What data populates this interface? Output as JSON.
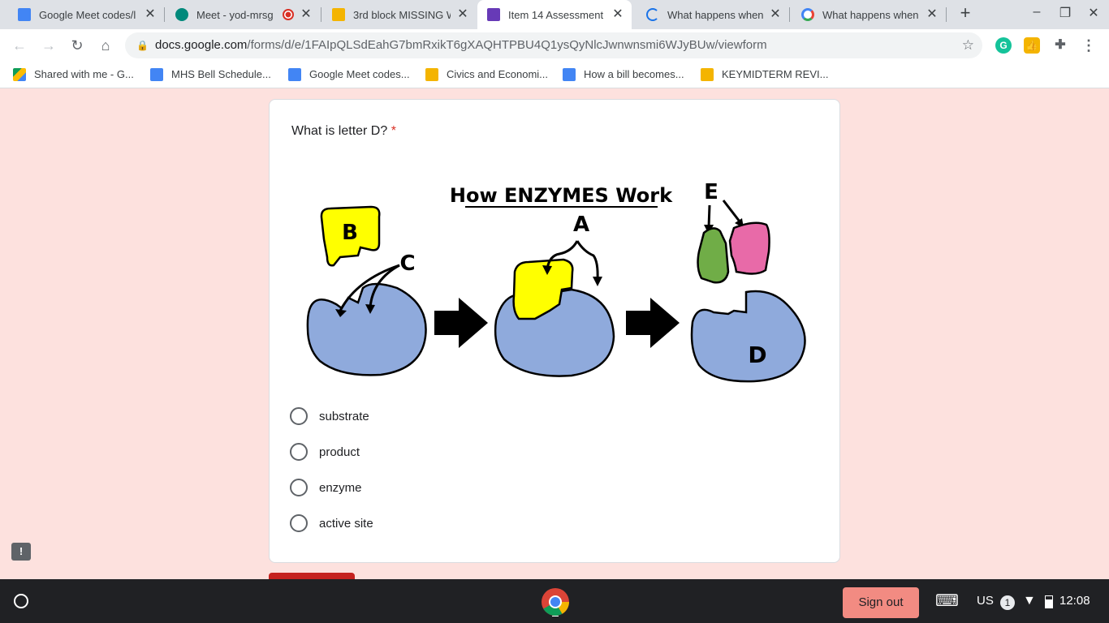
{
  "browser": {
    "tabs": [
      {
        "title": "Google Meet codes/l",
        "favicon_color": "#4285f4"
      },
      {
        "title": "Meet - yod-mrsg",
        "favicon_color": "#00897b"
      },
      {
        "title": "3rd block MISSING W",
        "favicon_color": "#f4b400"
      },
      {
        "title": "Item 14 Assessment",
        "favicon_color": "#673ab7"
      },
      {
        "title": "What happens when",
        "favicon_color": "#1a73e8"
      },
      {
        "title": "What happens when",
        "favicon_color": "#ea4335"
      }
    ],
    "address": {
      "host": "docs.google.com",
      "path": "/forms/d/e/1FAIpQLSdEahG7bmRxikT6gXAQHTPBU4Q1ysQyNlcJwnwnsmi6WJyBUw/viewform"
    },
    "bookmarks": [
      {
        "label": "Shared with me - G...",
        "icon_color": "#fbbc04"
      },
      {
        "label": "MHS Bell Schedule...",
        "icon_color": "#4285f4"
      },
      {
        "label": "Google Meet codes...",
        "icon_color": "#4285f4"
      },
      {
        "label": "Civics and Economi...",
        "icon_color": "#f4b400"
      },
      {
        "label": "How a bill becomes...",
        "icon_color": "#4285f4"
      },
      {
        "label": "KEYMIDTERM REVI...",
        "icon_color": "#f4b400"
      }
    ]
  },
  "form": {
    "question": "What is letter D?",
    "required_mark": "*",
    "diagram": {
      "title": "How ENZYMES Work",
      "labels": {
        "a": "A",
        "b": "B",
        "c": "C",
        "d": "D",
        "e": "E"
      }
    },
    "options": [
      "substrate",
      "product",
      "enzyme",
      "active site"
    ],
    "feedback_icon": "!"
  },
  "shelf": {
    "sign_out": "Sign out",
    "input_method": "US",
    "notification_count": "1",
    "time": "12:08"
  },
  "colors": {
    "page_bg": "#fde1de",
    "required": "#d93025",
    "enzyme_blue": "#8faadc",
    "substrate_yellow": "#ffff00",
    "product_green": "#70ad47",
    "product_pink": "#e86aa8"
  }
}
